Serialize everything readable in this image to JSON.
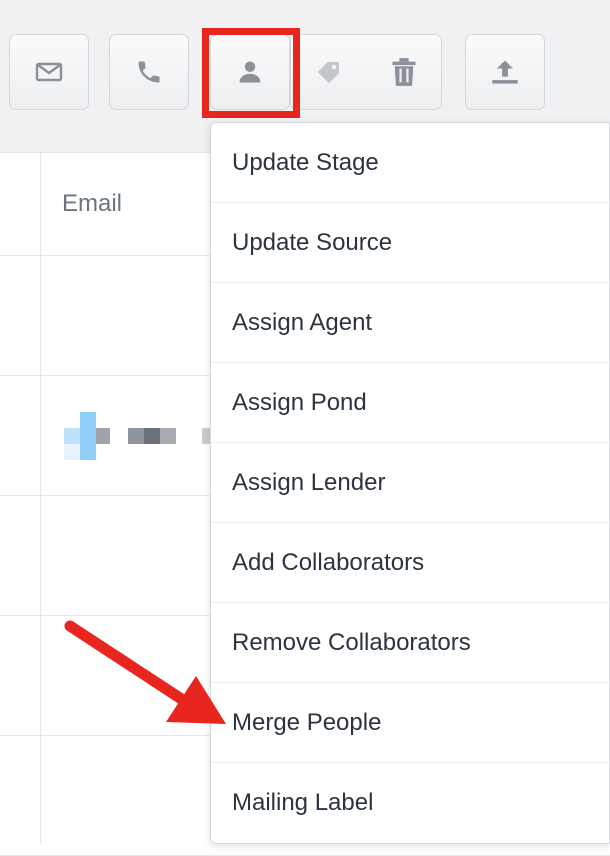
{
  "toolbar": {
    "buttons": [
      {
        "name": "email",
        "icon": "envelope-icon"
      },
      {
        "name": "call",
        "icon": "phone-icon"
      },
      {
        "name": "assign-person",
        "icon": "person-icon",
        "highlighted": true
      },
      {
        "name": "tag",
        "icon": "tag-icon"
      },
      {
        "name": "delete",
        "icon": "trash-icon"
      },
      {
        "name": "export",
        "icon": "upload-icon"
      }
    ]
  },
  "table": {
    "columns": [
      "Email"
    ]
  },
  "menu": {
    "items": [
      "Update Stage",
      "Update Source",
      "Assign Agent",
      "Assign Pond",
      "Assign Lender",
      "Add Collaborators",
      "Remove Collaborators",
      "Merge People",
      "Mailing Label"
    ],
    "pointed_item": "Merge People"
  },
  "colors": {
    "highlight": "#e8251e",
    "arrow": "#e8251e",
    "icon": "#8a9199",
    "menu_text": "#2c3440"
  }
}
